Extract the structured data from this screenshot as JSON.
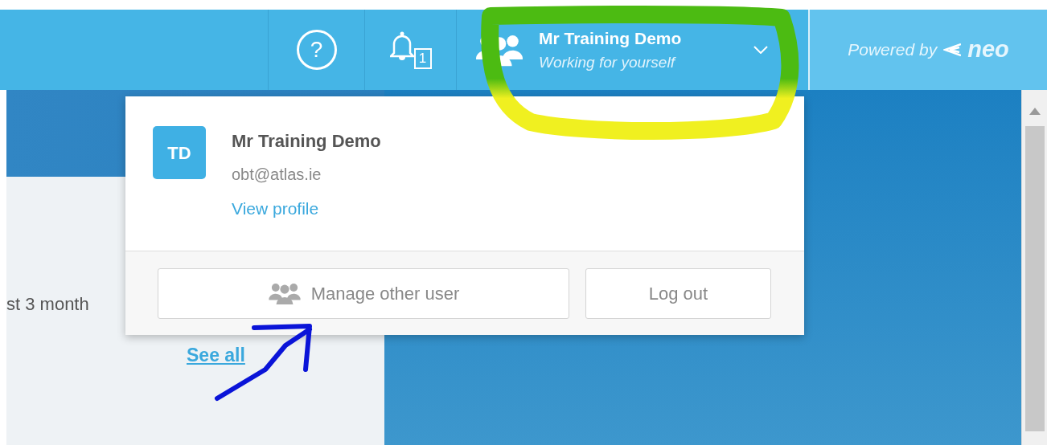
{
  "header": {
    "help_label": "?",
    "notification_count": "1",
    "user": {
      "name": "Mr Training Demo",
      "subtitle": "Working for yourself"
    },
    "powered_by": "Powered by",
    "brand": "neo"
  },
  "background": {
    "summary_text": "st 3 month",
    "link": "See all"
  },
  "dropdown": {
    "initials": "TD",
    "name": "Mr Training Demo",
    "email": "obt@atlas.ie",
    "profile_link": "View profile",
    "buttons": [
      {
        "label": "Manage other user",
        "kind": "with-icon"
      },
      {
        "label": "Log out",
        "kind": "plain"
      }
    ]
  },
  "annotations": [
    {
      "kind": "circle",
      "color": "#4cbb12"
    },
    {
      "kind": "arrow",
      "color": "#0a14d8"
    }
  ]
}
